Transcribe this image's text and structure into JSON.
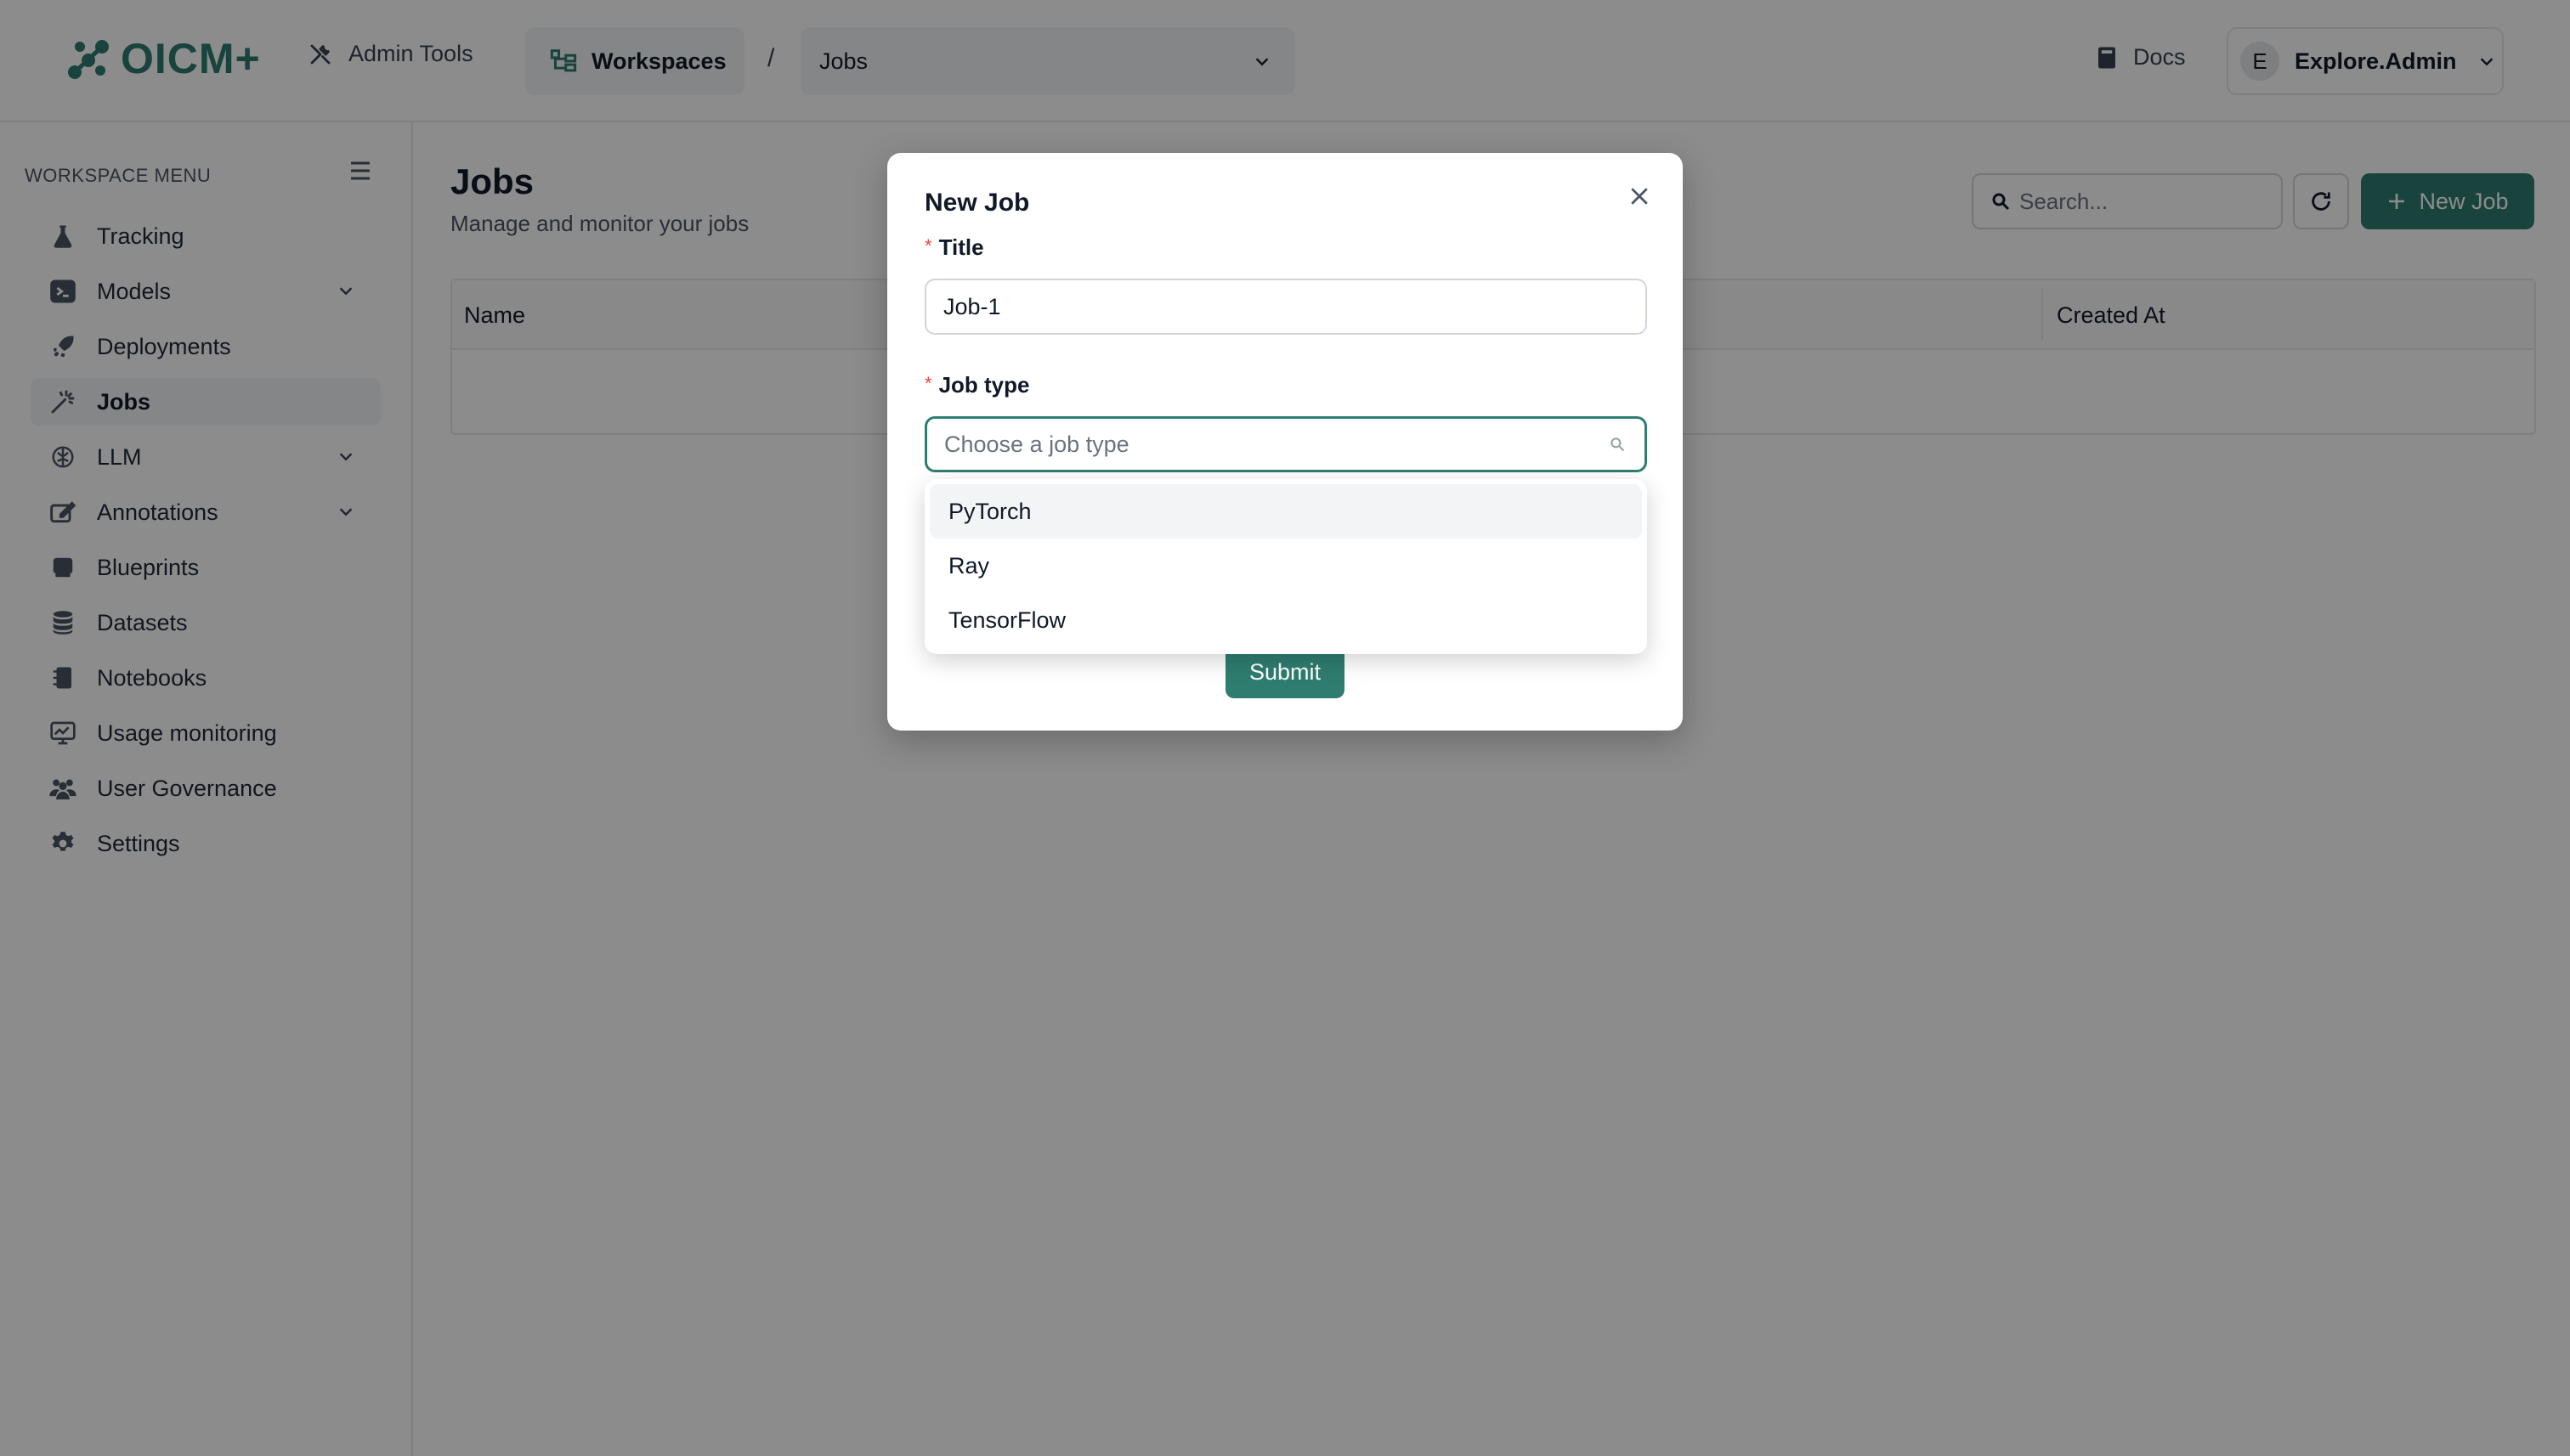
{
  "header": {
    "logo_text": "OICM+",
    "admin_tools_label": "Admin Tools",
    "workspaces_label": "Workspaces",
    "separator": "/",
    "workspace_select_value": "Jobs",
    "docs_label": "Docs",
    "user_initial": "E",
    "user_name": "Explore.Admin"
  },
  "sidebar": {
    "title": "WORKSPACE MENU",
    "items": [
      {
        "label": "Tracking",
        "icon": "flask-icon"
      },
      {
        "label": "Models",
        "icon": "model-icon",
        "expandable": true
      },
      {
        "label": "Deployments",
        "icon": "rocket-icon"
      },
      {
        "label": "Jobs",
        "icon": "magic-wand-icon",
        "active": true
      },
      {
        "label": "LLM",
        "icon": "brain-icon",
        "expandable": true
      },
      {
        "label": "Annotations",
        "icon": "annotation-icon",
        "expandable": true
      },
      {
        "label": "Blueprints",
        "icon": "blueprint-icon"
      },
      {
        "label": "Datasets",
        "icon": "database-icon"
      },
      {
        "label": "Notebooks",
        "icon": "notebook-icon"
      },
      {
        "label": "Usage monitoring",
        "icon": "monitor-chart-icon"
      },
      {
        "label": "User Governance",
        "icon": "users-icon"
      },
      {
        "label": "Settings",
        "icon": "gear-icon"
      }
    ]
  },
  "main": {
    "title": "Jobs",
    "subtitle": "Manage and monitor your jobs",
    "search_placeholder": "Search...",
    "new_job_label": "New Job",
    "table": {
      "columns": [
        "Name",
        "Created At"
      ]
    }
  },
  "modal": {
    "title": "New Job",
    "title_field_label": "Title",
    "title_field_value": "Job-1",
    "job_type_label": "Job type",
    "job_type_placeholder": "Choose a job type",
    "submit_label": "Submit",
    "job_type_options": [
      "PyTorch",
      "Ray",
      "TensorFlow"
    ],
    "highlighted_option": "PyTorch"
  },
  "colors": {
    "accent": "#2f7d70",
    "required": "#ef4444"
  }
}
